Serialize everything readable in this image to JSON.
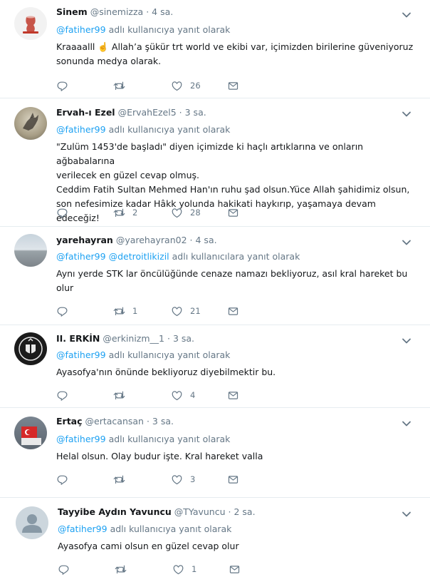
{
  "tweets": [
    {
      "name": "Sinem",
      "handle": "@sinemizza",
      "dot": "·",
      "time": "4 sa.",
      "reply_mentions": [
        "@fatiher99"
      ],
      "reply_text": "adlı kullanıcıya yanıt olarak",
      "body": [
        "Kraaaalll ☝️ Allah’a şükür trt world ve ekibi var, içimizden birilerine güveniyoruz",
        "sonunda medya olarak."
      ],
      "retweets": "",
      "likes": "26",
      "avatar": "tea-glass-avatar"
    },
    {
      "name": "Ervah-ı Ezel",
      "handle": "@ErvahEzel5",
      "dot": "·",
      "time": "3 sa.",
      "reply_mentions": [
        "@fatiher99"
      ],
      "reply_text": "adlı kullanıcıya yanıt olarak",
      "body": [
        "\"Zulüm 1453'de başladı\" diyen içimizde ki haçlı artıklarına ve onların ağbabalarına",
        "verilecek en güzel cevap olmuş.",
        "Ceddim Fatih Sultan Mehmed Han'ın ruhu şad olsun.Yüce Allah şahidimiz olsun,",
        "son nefesimize kadar Hâkk yolunda hakikati haykırıp, yaşamaya devam edeceğiz!"
      ],
      "retweets": "2",
      "likes": "28",
      "avatar": "horse-avatar"
    },
    {
      "name": "yarehayran",
      "handle": "@yarehayran02",
      "dot": "·",
      "time": "4 sa.",
      "reply_mentions": [
        "@fatiher99",
        "@detroitlikizil"
      ],
      "reply_text": "adlı kullanıcılara yanıt olarak",
      "body": [
        "Aynı yerde STK lar öncülüğünde cenaze namazı bekliyoruz, asıl kral hareket bu",
        "olur"
      ],
      "retweets": "1",
      "likes": "21",
      "avatar": "landscape-avatar"
    },
    {
      "name": "II. ERKİN",
      "handle": "@erkinizm__1",
      "dot": "·",
      "time": "3 sa.",
      "reply_mentions": [
        "@fatiher99"
      ],
      "reply_text": "adlı kullanıcıya yanıt olarak",
      "body": [
        "Ayasofya'nın önünde bekliyoruz diyebilmektir bu."
      ],
      "retweets": "",
      "likes": "4",
      "avatar": "crest-avatar"
    },
    {
      "name": "Ertaç",
      "handle": "@ertacansan",
      "dot": "·",
      "time": "3 sa.",
      "reply_mentions": [
        "@fatiher99"
      ],
      "reply_text": "adlı kullanıcıya yanıt olarak",
      "body": [
        "Helal olsun. Olay budur işte. Kral hareket valla"
      ],
      "retweets": "",
      "likes": "3",
      "avatar": "flag-avatar"
    },
    {
      "name": "Tayyibe Aydın Yavuncu",
      "handle": "@TYavuncu",
      "dot": "·",
      "time": "2 sa.",
      "reply_mentions": [
        "@fatiher99"
      ],
      "reply_text": "adlı kullanıcıya yanıt olarak",
      "body": [
        "Ayasofya cami olsun en güzel cevap olur"
      ],
      "retweets": "",
      "likes": "1",
      "avatar": "default-user-avatar"
    }
  ]
}
